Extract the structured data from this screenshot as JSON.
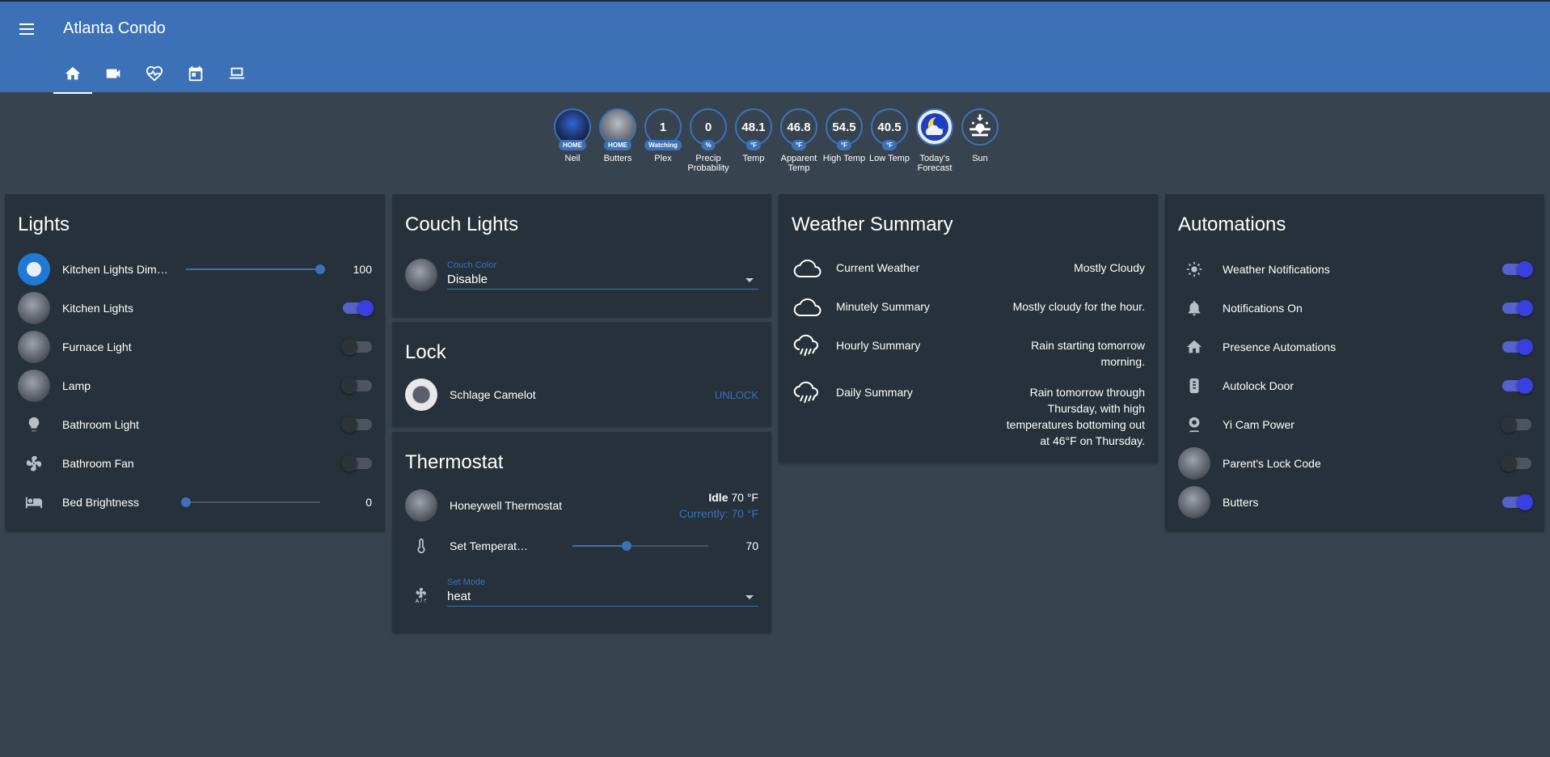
{
  "app": {
    "title": "Atlanta Condo"
  },
  "tabs": [
    "home-tab",
    "camera-tab",
    "health-tab",
    "calendar-tab",
    "computer-tab"
  ],
  "badges": [
    {
      "value": "",
      "tag": "HOME",
      "label": "Neil"
    },
    {
      "value": "",
      "tag": "HOME",
      "label": "Butters"
    },
    {
      "value": "1",
      "tag": "Watching",
      "label": "Plex"
    },
    {
      "value": "0",
      "tag": "%",
      "label": "Precip Probability"
    },
    {
      "value": "48.1",
      "tag": "°F",
      "label": "Temp"
    },
    {
      "value": "46.8",
      "tag": "°F",
      "label": "Apparent Temp"
    },
    {
      "value": "54.5",
      "tag": "°F",
      "label": "High Temp"
    },
    {
      "value": "40.5",
      "tag": "°F",
      "label": "Low Temp"
    },
    {
      "value": "",
      "tag": "",
      "label": "Today's Forecast"
    },
    {
      "value": "",
      "tag": "",
      "label": "Sun"
    }
  ],
  "lights": {
    "title": "Lights",
    "items": [
      {
        "name": "Kitchen Lights Dimm...",
        "control": "slider",
        "value": "100",
        "level": 100
      },
      {
        "name": "Kitchen Lights",
        "control": "toggle",
        "on": true
      },
      {
        "name": "Furnace Light",
        "control": "toggle",
        "on": false
      },
      {
        "name": "Lamp",
        "control": "toggle",
        "on": false
      },
      {
        "name": "Bathroom Light",
        "control": "toggle",
        "on": false
      },
      {
        "name": "Bathroom Fan",
        "control": "toggle",
        "on": false
      },
      {
        "name": "Bed Brightness",
        "control": "slider",
        "value": "0",
        "level": 0
      }
    ]
  },
  "couch": {
    "title": "Couch Lights",
    "select_label": "Couch Color",
    "select_value": "Disable"
  },
  "lock": {
    "title": "Lock",
    "name": "Schlage Camelot",
    "action": "UNLOCK"
  },
  "thermostat": {
    "title": "Thermostat",
    "name": "Honeywell Thermostat",
    "state": "Idle",
    "target": "70 °F",
    "current": "Currently: 70 °F",
    "set_temp_label": "Set Temperature",
    "set_temp_value": "70",
    "set_temp_level": 40,
    "mode_label": "Set Mode",
    "mode_value": "heat"
  },
  "weather": {
    "title": "Weather Summary",
    "items": [
      {
        "name": "Current Weather",
        "value": "Mostly Cloudy",
        "icon": "cloud-icon"
      },
      {
        "name": "Minutely Summary",
        "value": "Mostly cloudy for the hour.",
        "icon": "cloud-icon"
      },
      {
        "name": "Hourly Summary",
        "value": "Rain starting tomorrow morning.",
        "icon": "rain-icon"
      },
      {
        "name": "Daily Summary",
        "value": "Rain tomorrow through Thursday, with high temperatures bottoming out at 46°F on Thursday.",
        "icon": "rain-icon"
      }
    ]
  },
  "automations": {
    "title": "Automations",
    "items": [
      {
        "name": "Weather Notifications",
        "on": true
      },
      {
        "name": "Notifications On",
        "on": true
      },
      {
        "name": "Presence Automations",
        "on": true
      },
      {
        "name": "Autolock Door",
        "on": true
      },
      {
        "name": "Yi Cam Power",
        "on": false
      },
      {
        "name": "Parent's Lock Code",
        "on": false
      },
      {
        "name": "Butters",
        "on": true
      }
    ]
  },
  "colors": {
    "primary": "#3c71b8",
    "background": "#37444f",
    "card": "#26313b",
    "toggle_on": "#3a3fe0"
  }
}
